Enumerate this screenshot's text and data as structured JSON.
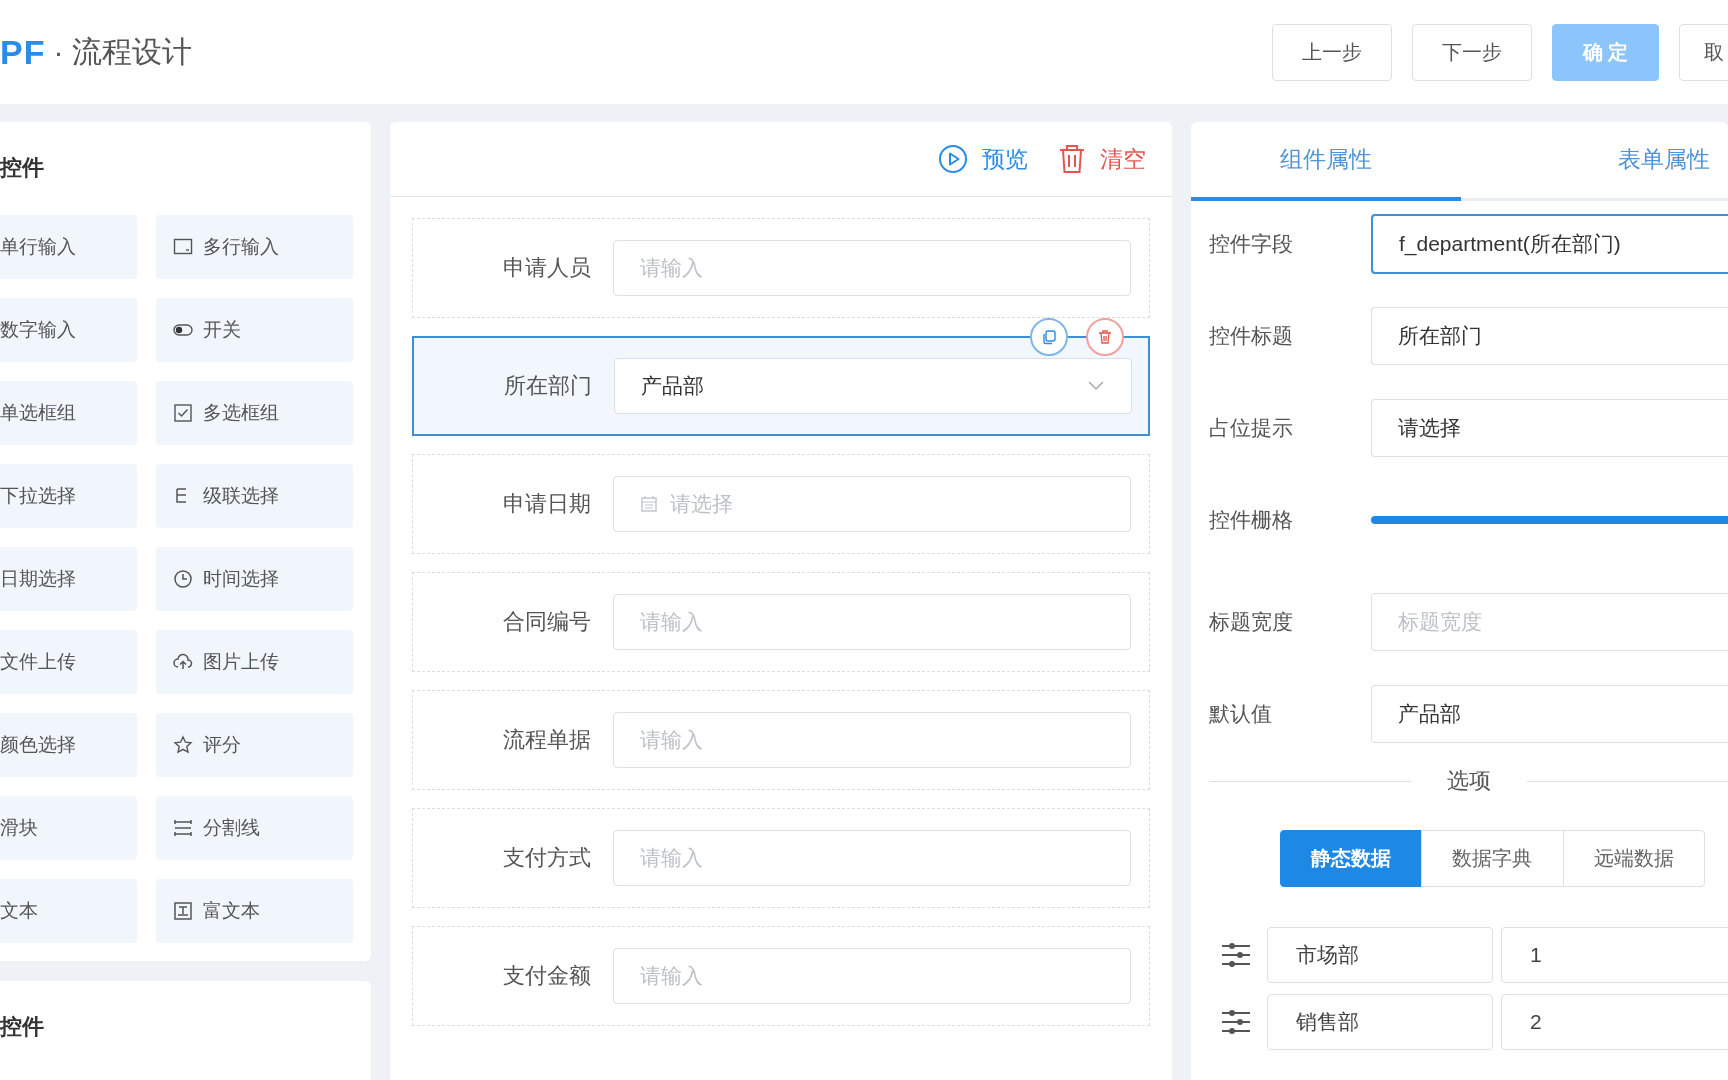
{
  "header": {
    "logo": "PF",
    "title": "· 流程设计",
    "buttons": [
      {
        "label": "上一步",
        "kind": "default"
      },
      {
        "label": "下一步",
        "kind": "default"
      },
      {
        "label": "确 定",
        "kind": "primary",
        "disabled": true
      },
      {
        "label": "取",
        "kind": "default"
      }
    ]
  },
  "palette": [
    {
      "title": "控件",
      "items": [
        "单行输入",
        "多行输入",
        "数字输入",
        "开关",
        "单选框组",
        "多选框组",
        "下拉选择",
        "级联选择",
        "日期选择",
        "时间选择",
        "文件上传",
        "图片上传",
        "颜色选择",
        "评分",
        "滑块",
        "分割线",
        "文本",
        "富文本"
      ]
    },
    {
      "title": "控件"
    }
  ],
  "canvas": {
    "toolbar": [
      {
        "label": "预览",
        "kind": "preview"
      },
      {
        "label": "清空",
        "kind": "clear"
      }
    ],
    "fields": [
      {
        "label": "申请人员",
        "kind": "input",
        "placeholder": "请输入",
        "selected": false
      },
      {
        "label": "所在部门",
        "kind": "select",
        "value": "产品部",
        "selected": true
      },
      {
        "label": "申请日期",
        "kind": "date",
        "placeholder": "请选择",
        "selected": false
      },
      {
        "label": "合同编号",
        "kind": "input",
        "placeholder": "请输入",
        "selected": false
      },
      {
        "label": "流程单据",
        "kind": "input",
        "placeholder": "请输入",
        "selected": false
      },
      {
        "label": "支付方式",
        "kind": "input",
        "placeholder": "请输入",
        "selected": false
      },
      {
        "label": "支付金额",
        "kind": "input",
        "placeholder": "请输入",
        "selected": false
      }
    ]
  },
  "properties": {
    "tabs": [
      {
        "label": "组件属性",
        "selected": true
      },
      {
        "label": "表单属性",
        "selected": false
      }
    ],
    "fields": [
      {
        "label": "控件字段",
        "kind": "input",
        "value": "f_department(所在部门)",
        "focused": true
      },
      {
        "label": "控件标题",
        "kind": "input",
        "value": "所在部门",
        "focused": false
      },
      {
        "label": "占位提示",
        "kind": "input",
        "value": "请选择",
        "focused": false
      },
      {
        "label": "控件栅格",
        "kind": "slider",
        "level": 1
      },
      {
        "label": "标题宽度",
        "kind": "input",
        "placeholder": "标题宽度",
        "focused": false
      },
      {
        "label": "默认值",
        "kind": "input",
        "value": "产品部",
        "focused": false
      }
    ],
    "options_title": "选项",
    "sources": [
      {
        "label": "静态数据",
        "selected": true
      },
      {
        "label": "数据字典",
        "selected": false
      },
      {
        "label": "远端数据",
        "selected": false
      }
    ],
    "options": [
      {
        "label": "市场部",
        "value": "1"
      },
      {
        "label": "销售部",
        "value": "2"
      }
    ]
  }
}
